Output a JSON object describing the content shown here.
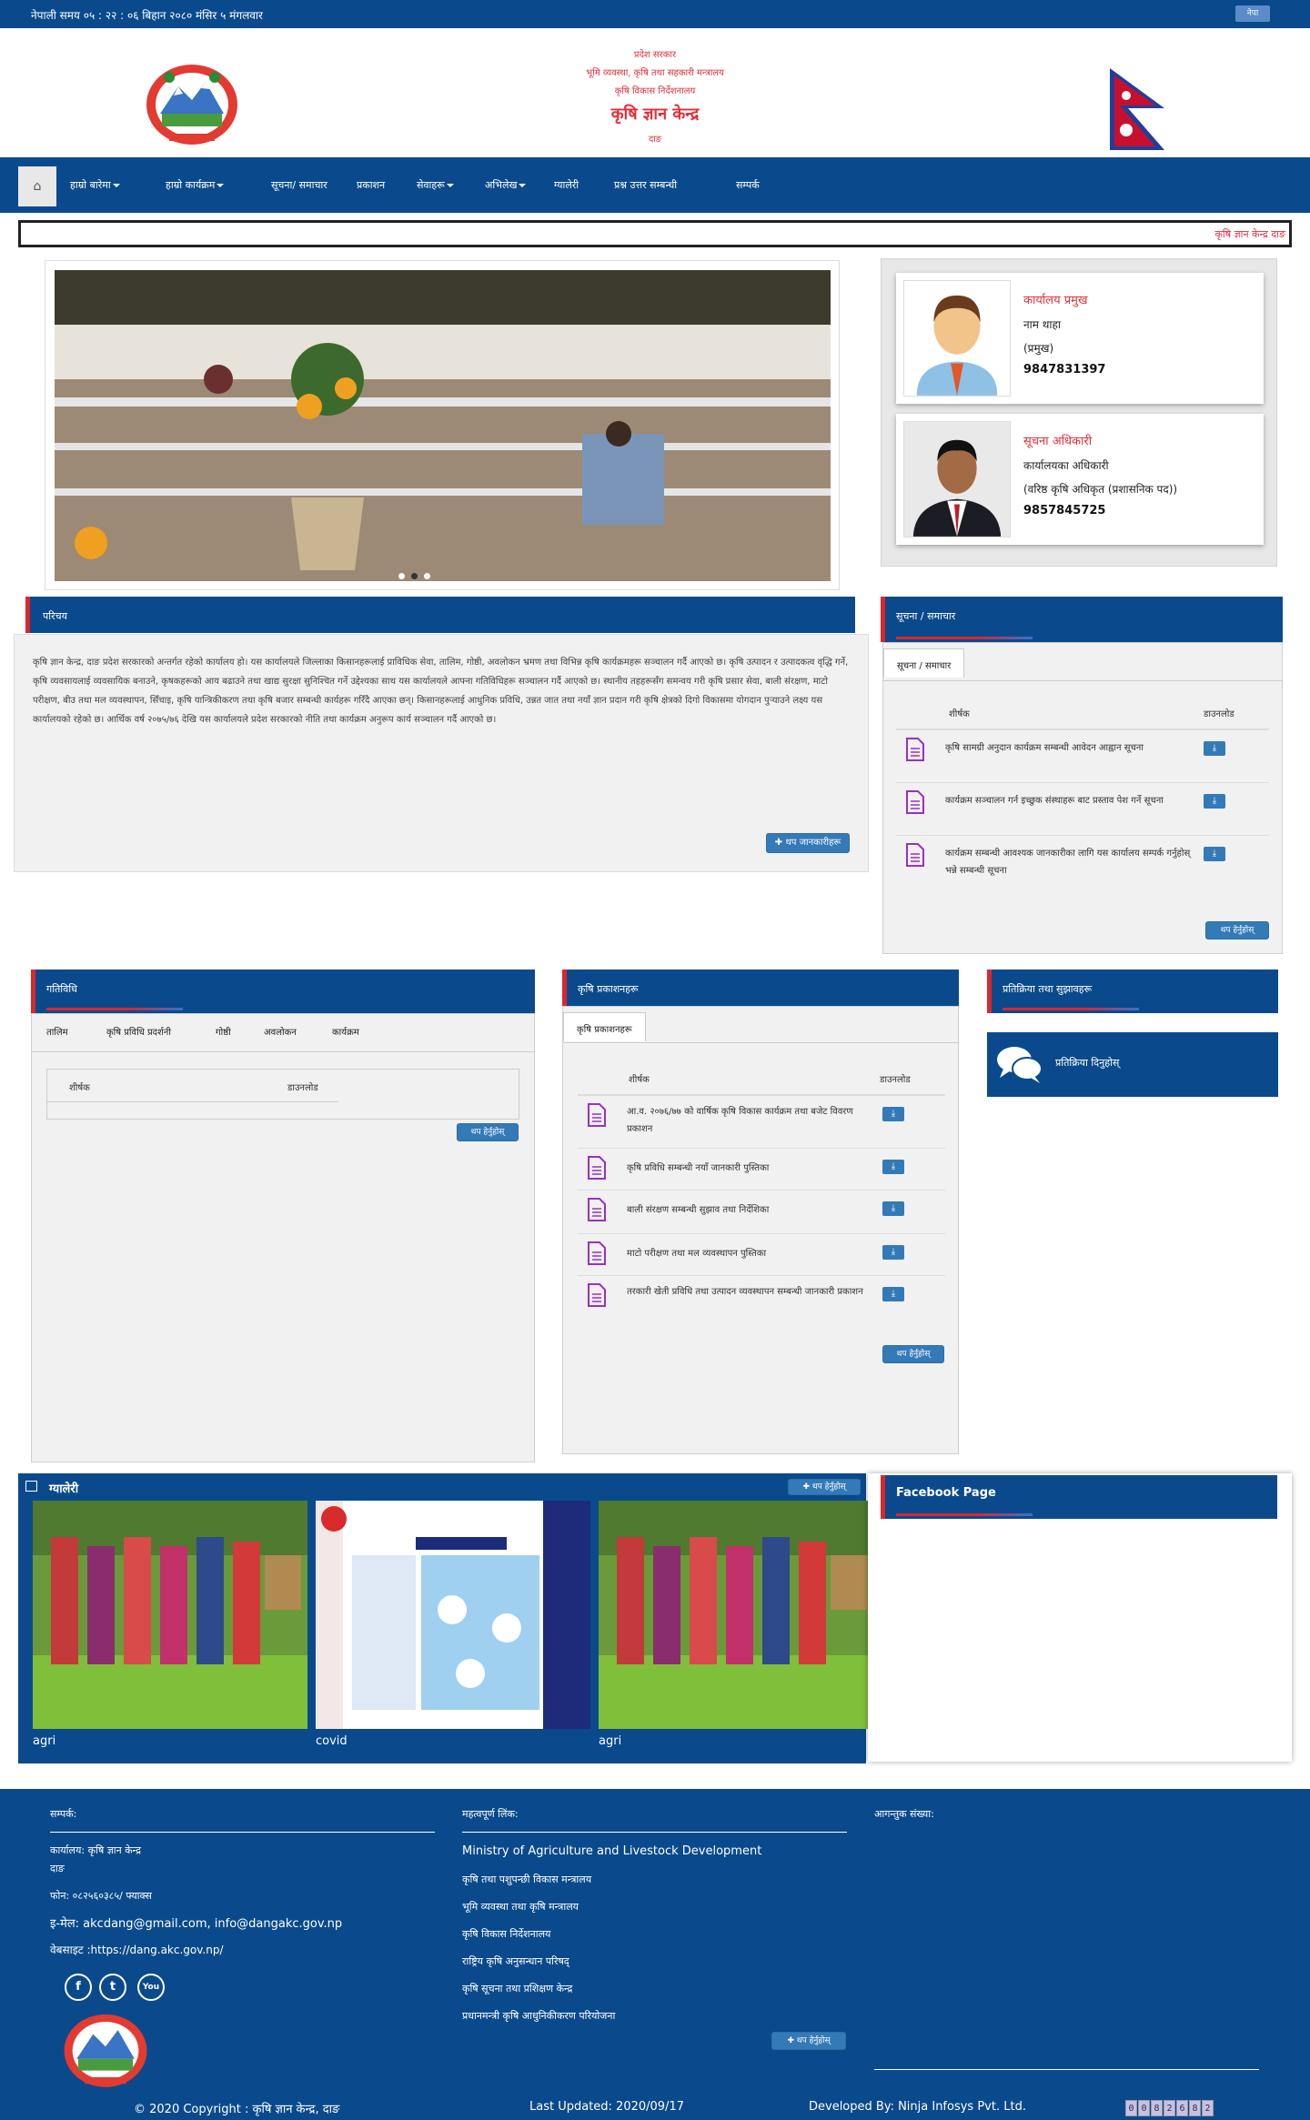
{
  "topbar": {
    "time": "नेपाली समय ०५ : २२ : ०६ बिहान  २०८० मंसिर ५ मंगलवार",
    "lang_button": "नेपा"
  },
  "header": {
    "line1": "प्रदेश सरकार",
    "line2": "भूमि व्यवस्था, कृषि तथा सहकारी मन्त्रालय",
    "line3": "कृषि विकास निर्देशनालय",
    "office": "कृषि ज्ञान केन्द्र",
    "location": "दाङ"
  },
  "nav": {
    "home_icon": "home-icon",
    "items": [
      "हाम्रो बारेमा",
      "हाम्रो कार्यक्रम",
      "सूचना/ समाचार",
      "प्रकाशन",
      "सेवाहरू",
      "अभिलेख",
      "ग्यालेरी",
      "प्रश्न उत्तर सम्बन्धी",
      "सम्पर्क"
    ]
  },
  "marquee": "कृषि ज्ञान केन्द्र दाङ",
  "officials": [
    {
      "role": "कार्यालय प्रमुख",
      "name": "नाम थाहा",
      "designation": "(प्रमुख)",
      "phone": "9847831397"
    },
    {
      "role": "सूचना अधिकारी",
      "name": "कार्यालयका अधिकारी",
      "designation": "(वरिष्ठ कृषि अधिकृत (प्रशासनिक पद))",
      "phone": "9857845725"
    }
  ],
  "about": {
    "title": "परिचय",
    "body": "कृषि ज्ञान केन्द्र, दाङ प्रदेश सरकारको अन्तर्गत रहेको कार्यालय हो। यस कार्यालयले जिल्लाका किसानहरूलाई प्राविधिक सेवा, तालिम, गोष्ठी, अवलोकन भ्रमण तथा विभिन्न कृषि कार्यक्रमहरू सञ्चालन गर्दै आएको छ। कृषि उत्पादन र उत्पादकत्व वृद्धि गर्ने, कृषि व्यवसायलाई व्यवसायिक बनाउने, कृषकहरूको आय बढाउने तथा खाद्य सुरक्षा सुनिश्चित गर्ने उद्देश्यका साथ यस कार्यालयले आफ्ना गतिविधिहरू सञ्चालन गर्दै आएको छ। स्थानीय तहहरूसँग समन्वय गरी कृषि प्रसार सेवा, बाली संरक्षण, माटो परीक्षण, बीउ तथा मल व्यवस्थापन, सिँचाइ, कृषि यान्त्रिकीकरण तथा कृषि बजार सम्बन्धी कार्यहरू गरिँदै आएका छन्। किसानहरूलाई आधुनिक प्रविधि, उन्नत जात तथा नयाँ ज्ञान प्रदान गरी कृषि क्षेत्रको दिगो विकासमा योगदान पुर्‍याउने लक्ष्य यस कार्यालयको रहेको छ। आर्थिक वर्ष २०७५/७६ देखि यस कार्यालयले प्रदेश सरकारको नीति तथा कार्यक्रम अनुरूप कार्य सञ्चालन गर्दै आएको छ।",
    "more_button": "थप जानकारीहरू"
  },
  "notices": {
    "title": "सूचना / समाचार",
    "tab": "सूचना / समाचार",
    "col_title": "शीर्षक",
    "col_download": "डाउनलोड",
    "rows": [
      "कृषि सामग्री अनुदान कार्यक्रम सम्बन्धी आवेदन आह्वान सूचना",
      "कार्यक्रम सञ्चालन गर्न इच्छुक संस्थाहरू बाट प्रस्ताव पेश गर्ने सूचना",
      "कार्यक्रम सम्बन्धी आवश्यक जानकारीका लागि यस कार्यालय सम्पर्क गर्नुहोस् भन्ने सम्बन्धी सूचना"
    ],
    "more_button": "थप हेर्नुहोस्"
  },
  "activities": {
    "title": "गतिविधि",
    "tabs": [
      "तालिम",
      "कृषि प्रविधि प्रदर्शनी",
      "गोष्ठी",
      "अवलोकन",
      "कार्यक्रम"
    ],
    "col_title": "शीर्षक",
    "col_download": "डाउनलोड",
    "more_button": "थप हेर्नुहोस्"
  },
  "publications": {
    "title": "कृषि प्रकाशनहरू",
    "tab": "कृषि प्रकाशनहरू",
    "col_title": "शीर्षक",
    "col_download": "डाउनलोड",
    "rows": [
      "आ.व. २०७६/७७ को वार्षिक कृषि विकास कार्यक्रम तथा बजेट विवरण प्रकाशन",
      "कृषि प्रविधि सम्बन्धी नयाँ जानकारी पुस्तिका",
      "बाली संरक्षण सम्बन्धी सुझाव तथा निर्देशिका",
      "माटो परीक्षण तथा मल व्यवस्थापन पुस्तिका",
      "तरकारी खेती प्रविधि तथा उत्पादन व्यवस्थापन सम्बन्धी जानकारी प्रकाशन"
    ],
    "more_button": "थप हेर्नुहोस्"
  },
  "feedback": {
    "title": "प्रतिक्रिया तथा सुझावहरू",
    "box_label": "प्रतिक्रिया दिनुहोस्",
    "icon": "chat-icon"
  },
  "gallery": {
    "title": "ग्यालेरी",
    "more_button": "थप हेर्नुहोस्",
    "items": [
      {
        "caption": "agri"
      },
      {
        "caption": "covid"
      },
      {
        "caption": "agri"
      }
    ]
  },
  "facebook": {
    "title": "Facebook Page"
  },
  "footer": {
    "contact_head": "सम्पर्क:",
    "contact": {
      "office": "कार्यालय: कृषि ज्ञान केन्द्र",
      "district": "दाङ",
      "phone": "फोन: ०८२५६०३८५/ फ्याक्स",
      "email": "इ-मेल: akcdang@gmail.com, info@dangakc.gov.np",
      "website": "वेबसाइट :https://dang.akc.gov.np/"
    },
    "links_head": "महत्वपूर्ण लिंक:",
    "links": [
      "Ministry of Agriculture and Livestock Development",
      "कृषि तथा पशुपन्छी विकास मन्त्रालय",
      "भूमि व्यवस्था तथा कृषि मन्त्रालय",
      "कृषि विकास निर्देशनालय",
      "राष्ट्रिय कृषि अनुसन्धान परिषद्",
      "कृषि सूचना तथा प्रशिक्षण केन्द्र",
      "प्रधानमन्त्री कृषि आधुनिकीकरण परियोजना"
    ],
    "links_more": "थप हेर्नुहोस्",
    "visitor_head": "आगन्तुक संख्या:",
    "copyright": "© 2020 Copyright : कृषि ज्ञान केन्द्र, दाङ",
    "updated": "Last Updated: 2020/09/17",
    "developer": "Developed By: Ninja Infosys Pvt. Ltd.",
    "counter": [
      "0",
      "0",
      "8",
      "2",
      "6",
      "8",
      "2"
    ]
  }
}
